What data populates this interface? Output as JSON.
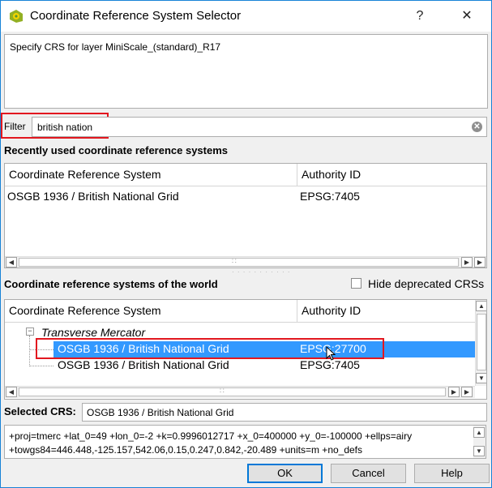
{
  "window": {
    "title": "Coordinate Reference System Selector",
    "help_glyph": "?",
    "close_glyph": "✕"
  },
  "description": "Specify CRS for layer MiniScale_(standard)_R17",
  "filter": {
    "label": "Filter",
    "value": "british nation",
    "clear_glyph": "✕"
  },
  "recent": {
    "title": "Recently used coordinate reference systems",
    "columns": [
      "Coordinate Reference System",
      "Authority ID"
    ],
    "rows": [
      {
        "name": "OSGB 1936 / British National Grid",
        "authid": "EPSG:7405"
      }
    ]
  },
  "world": {
    "title": "Coordinate reference systems of the world",
    "hide_deprecated_label": "Hide deprecated CRSs",
    "hide_deprecated_checked": false,
    "columns": [
      "Coordinate Reference System",
      "Authority ID"
    ],
    "group": {
      "expander": "−",
      "label": "Transverse Mercator"
    },
    "rows": [
      {
        "name": "OSGB 1936 / British National Grid",
        "authid": "EPSG:27700",
        "selected": true
      },
      {
        "name": "OSGB 1936 / British National Grid",
        "authid": "EPSG:7405",
        "selected": false
      }
    ]
  },
  "selected_crs": {
    "label": "Selected CRS:",
    "value": "OSGB 1936 / British National Grid"
  },
  "proj_string": {
    "line1": "+proj=tmerc +lat_0=49 +lon_0=-2 +k=0.9996012717 +x_0=400000 +y_0=-100000 +ellps=airy",
    "line2": "+towgs84=446.448,-125.157,542.06,0.15,0.247,0.842,-20.489 +units=m +no_defs"
  },
  "buttons": {
    "ok": "OK",
    "cancel": "Cancel",
    "help": "Help"
  },
  "scroll_glyphs": {
    "left": "◀",
    "right": "▶",
    "up": "▲",
    "down": "▼",
    "grip": "∷"
  },
  "colors": {
    "selection": "#3399ff",
    "highlight_box": "#e2171f",
    "window_border": "#1883d7"
  }
}
